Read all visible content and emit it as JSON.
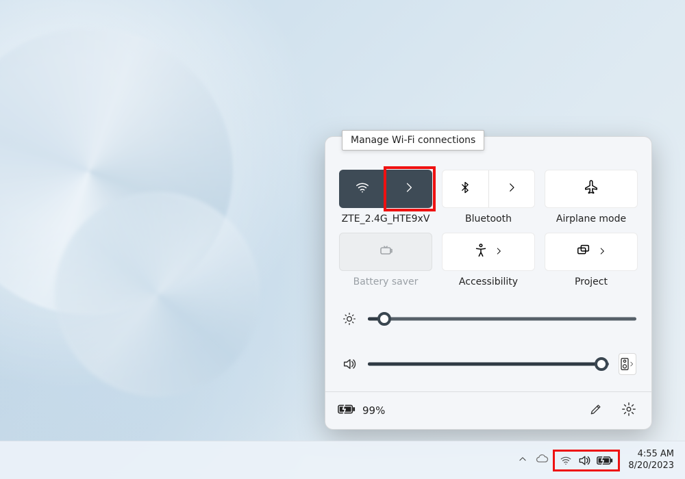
{
  "tooltip": "Manage Wi-Fi connections",
  "tiles": {
    "wifi": {
      "label": "ZTE_2.4G_HTE9xV"
    },
    "bluetooth": {
      "label": "Bluetooth"
    },
    "airplane": {
      "label": "Airplane mode"
    },
    "battery": {
      "label": "Battery saver"
    },
    "accessibility": {
      "label": "Accessibility"
    },
    "project": {
      "label": "Project"
    }
  },
  "sliders": {
    "brightness": {
      "value": 6
    },
    "volume": {
      "value": 97
    }
  },
  "footer": {
    "battery_pct": "99%"
  },
  "taskbar": {
    "time": "4:55 AM",
    "date": "8/20/2023"
  }
}
